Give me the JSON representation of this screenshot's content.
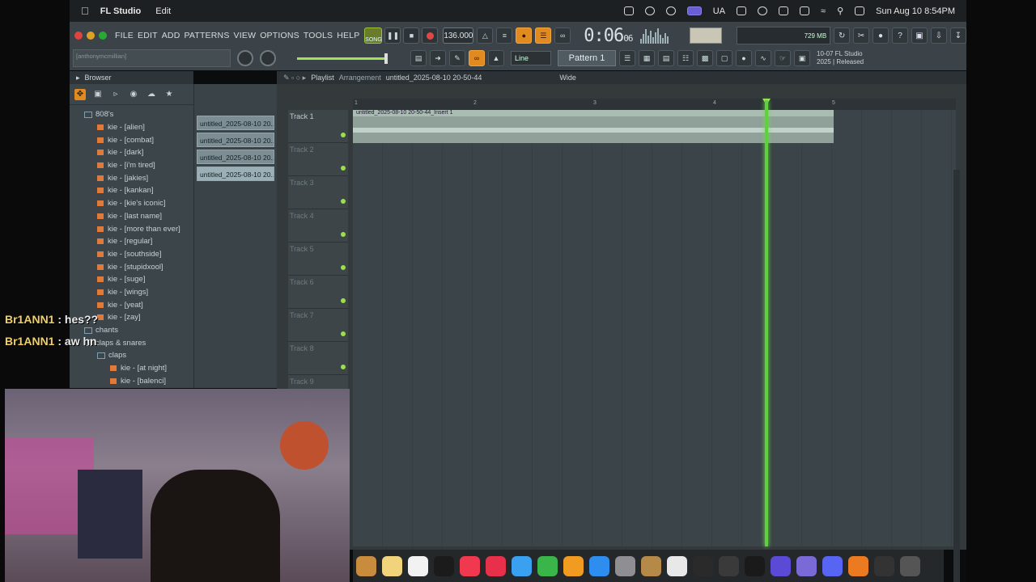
{
  "menubar": {
    "app_name": "FL Studio",
    "edit": "Edit",
    "clock": "Sun Aug 10  8:54PM",
    "lang": "UA"
  },
  "fl_menu": [
    "FILE",
    "EDIT",
    "ADD",
    "PATTERNS",
    "VIEW",
    "OPTIONS",
    "TOOLS",
    "HELP"
  ],
  "transport": {
    "song_label": "SONG",
    "tempo": "136.000",
    "time_main": "0:06",
    "time_sub": "06",
    "cpu_ram": "729 MB"
  },
  "hint_text": "[anthonymcmillian]",
  "snap": "Line",
  "pattern": "Pattern 1",
  "fl_version": [
    "10-07  FL Studio",
    "2025 | Released"
  ],
  "browser": {
    "title": "Browser",
    "items": [
      {
        "label": "808's",
        "type": "folder",
        "indent": 1
      },
      {
        "label": "kie - [alien]",
        "type": "file",
        "indent": 2
      },
      {
        "label": "kie - [combat]",
        "type": "file",
        "indent": 2
      },
      {
        "label": "kie - [dark]",
        "type": "file",
        "indent": 2
      },
      {
        "label": "kie - [i'm tired]",
        "type": "file",
        "indent": 2
      },
      {
        "label": "kie - [jakies]",
        "type": "file",
        "indent": 2
      },
      {
        "label": "kie - [kankan]",
        "type": "file",
        "indent": 2
      },
      {
        "label": "kie - [kie's iconic]",
        "type": "file",
        "indent": 2
      },
      {
        "label": "kie - [last name]",
        "type": "file",
        "indent": 2
      },
      {
        "label": "kie - [more than ever]",
        "type": "file",
        "indent": 2
      },
      {
        "label": "kie - [regular]",
        "type": "file",
        "indent": 2
      },
      {
        "label": "kie - [southside]",
        "type": "file",
        "indent": 2
      },
      {
        "label": "kie - [stupidxool]",
        "type": "file",
        "indent": 2
      },
      {
        "label": "kie - [suge]",
        "type": "file",
        "indent": 2
      },
      {
        "label": "kie - [wings]",
        "type": "file",
        "indent": 2
      },
      {
        "label": "kie - [yeat]",
        "type": "file",
        "indent": 2
      },
      {
        "label": "kie - [zay]",
        "type": "file",
        "indent": 2
      },
      {
        "label": "chants",
        "type": "folder",
        "indent": 1
      },
      {
        "label": "claps & snares",
        "type": "folder",
        "indent": 1
      },
      {
        "label": "claps",
        "type": "folder",
        "indent": 2
      },
      {
        "label": "kie - [at night]",
        "type": "file",
        "indent": 3
      },
      {
        "label": "kie - [balenci]",
        "type": "file",
        "indent": 3
      }
    ]
  },
  "picker": [
    "untitled_2025-08-10 20...",
    "untitled_2025-08-10 20...",
    "untitled_2025-08-10 20...",
    "untitled_2025-08-10 20..."
  ],
  "playlist": {
    "title": "Playlist",
    "breadcrumb": "Arrangement",
    "file": "untitled_2025-08-10 20-50-44",
    "mode": "Wide",
    "ruler": [
      "1",
      "2",
      "3",
      "4",
      "5"
    ],
    "clip_label": "untitled_2025-08-10 20-50-44_Insert 1",
    "tracks": [
      "Track 1",
      "Track 2",
      "Track 3",
      "Track 4",
      "Track 5",
      "Track 6",
      "Track 7",
      "Track 8",
      "Track 9"
    ]
  },
  "chat": [
    {
      "user": "Br1ANN1",
      "text": "hes??"
    },
    {
      "user": "Br1ANN1",
      "text": "aw hn"
    }
  ],
  "colors": {
    "accent": "#e08a1f",
    "playhead": "#5fd040",
    "clip": "#8fa199"
  }
}
